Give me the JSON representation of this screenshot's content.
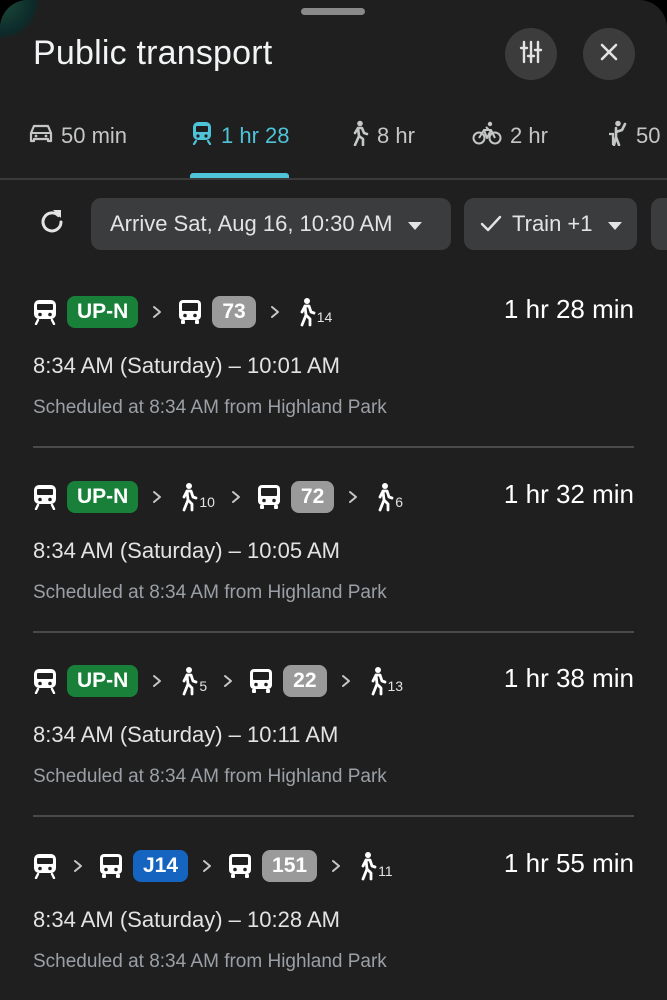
{
  "header": {
    "title": "Public transport",
    "filter_icon": "tune-icon",
    "close_icon": "close-icon"
  },
  "modes": [
    {
      "icon": "car-icon",
      "label": "50 min",
      "active": false
    },
    {
      "icon": "transit-icon",
      "label": "1 hr 28",
      "active": true
    },
    {
      "icon": "walk-icon",
      "label": "8 hr",
      "active": false
    },
    {
      "icon": "bike-icon",
      "label": "2 hr",
      "active": false
    },
    {
      "icon": "ride-hail-icon",
      "label": "50",
      "active": false
    }
  ],
  "controls": {
    "refresh_icon": "refresh-icon",
    "arrive_label": "Arrive Sat, Aug 16, 10:30 AM",
    "train_label": "Train +1"
  },
  "colors": {
    "accent": "#4fc3d8",
    "line_upn": "#188038",
    "line_j14": "#1565c0",
    "bus_route": "#9a9a9a"
  },
  "routes": [
    {
      "segments": [
        {
          "type": "train"
        },
        {
          "type": "badge",
          "text": "UP-N",
          "color": "green"
        },
        {
          "type": "chev"
        },
        {
          "type": "bus"
        },
        {
          "type": "badge",
          "text": "73",
          "color": "gray"
        },
        {
          "type": "chev"
        },
        {
          "type": "walk",
          "minutes": "14"
        }
      ],
      "duration": "1 hr 28 min",
      "times": "8:34 AM (Saturday) – 10:01 AM",
      "schedule": "Scheduled at 8:34 AM from Highland Park"
    },
    {
      "segments": [
        {
          "type": "train"
        },
        {
          "type": "badge",
          "text": "UP-N",
          "color": "green"
        },
        {
          "type": "chev"
        },
        {
          "type": "walk",
          "minutes": "10"
        },
        {
          "type": "chev"
        },
        {
          "type": "bus"
        },
        {
          "type": "badge",
          "text": "72",
          "color": "gray"
        },
        {
          "type": "chev"
        },
        {
          "type": "walk",
          "minutes": "6"
        }
      ],
      "duration": "1 hr 32 min",
      "times": "8:34 AM (Saturday) – 10:05 AM",
      "schedule": "Scheduled at 8:34 AM from Highland Park"
    },
    {
      "segments": [
        {
          "type": "train"
        },
        {
          "type": "badge",
          "text": "UP-N",
          "color": "green"
        },
        {
          "type": "chev"
        },
        {
          "type": "walk",
          "minutes": "5"
        },
        {
          "type": "chev"
        },
        {
          "type": "bus"
        },
        {
          "type": "badge",
          "text": "22",
          "color": "gray"
        },
        {
          "type": "chev"
        },
        {
          "type": "walk",
          "minutes": "13"
        }
      ],
      "duration": "1 hr 38 min",
      "times": "8:34 AM (Saturday) – 10:11 AM",
      "schedule": "Scheduled at 8:34 AM from Highland Park"
    },
    {
      "segments": [
        {
          "type": "train"
        },
        {
          "type": "chev"
        },
        {
          "type": "bus"
        },
        {
          "type": "badge",
          "text": "J14",
          "color": "blue"
        },
        {
          "type": "chev"
        },
        {
          "type": "bus"
        },
        {
          "type": "badge",
          "text": "151",
          "color": "gray"
        },
        {
          "type": "chev"
        },
        {
          "type": "walk",
          "minutes": "11"
        }
      ],
      "duration": "1 hr 55 min",
      "times": "8:34 AM (Saturday) – 10:28 AM",
      "schedule": "Scheduled at 8:34 AM from Highland Park"
    }
  ]
}
